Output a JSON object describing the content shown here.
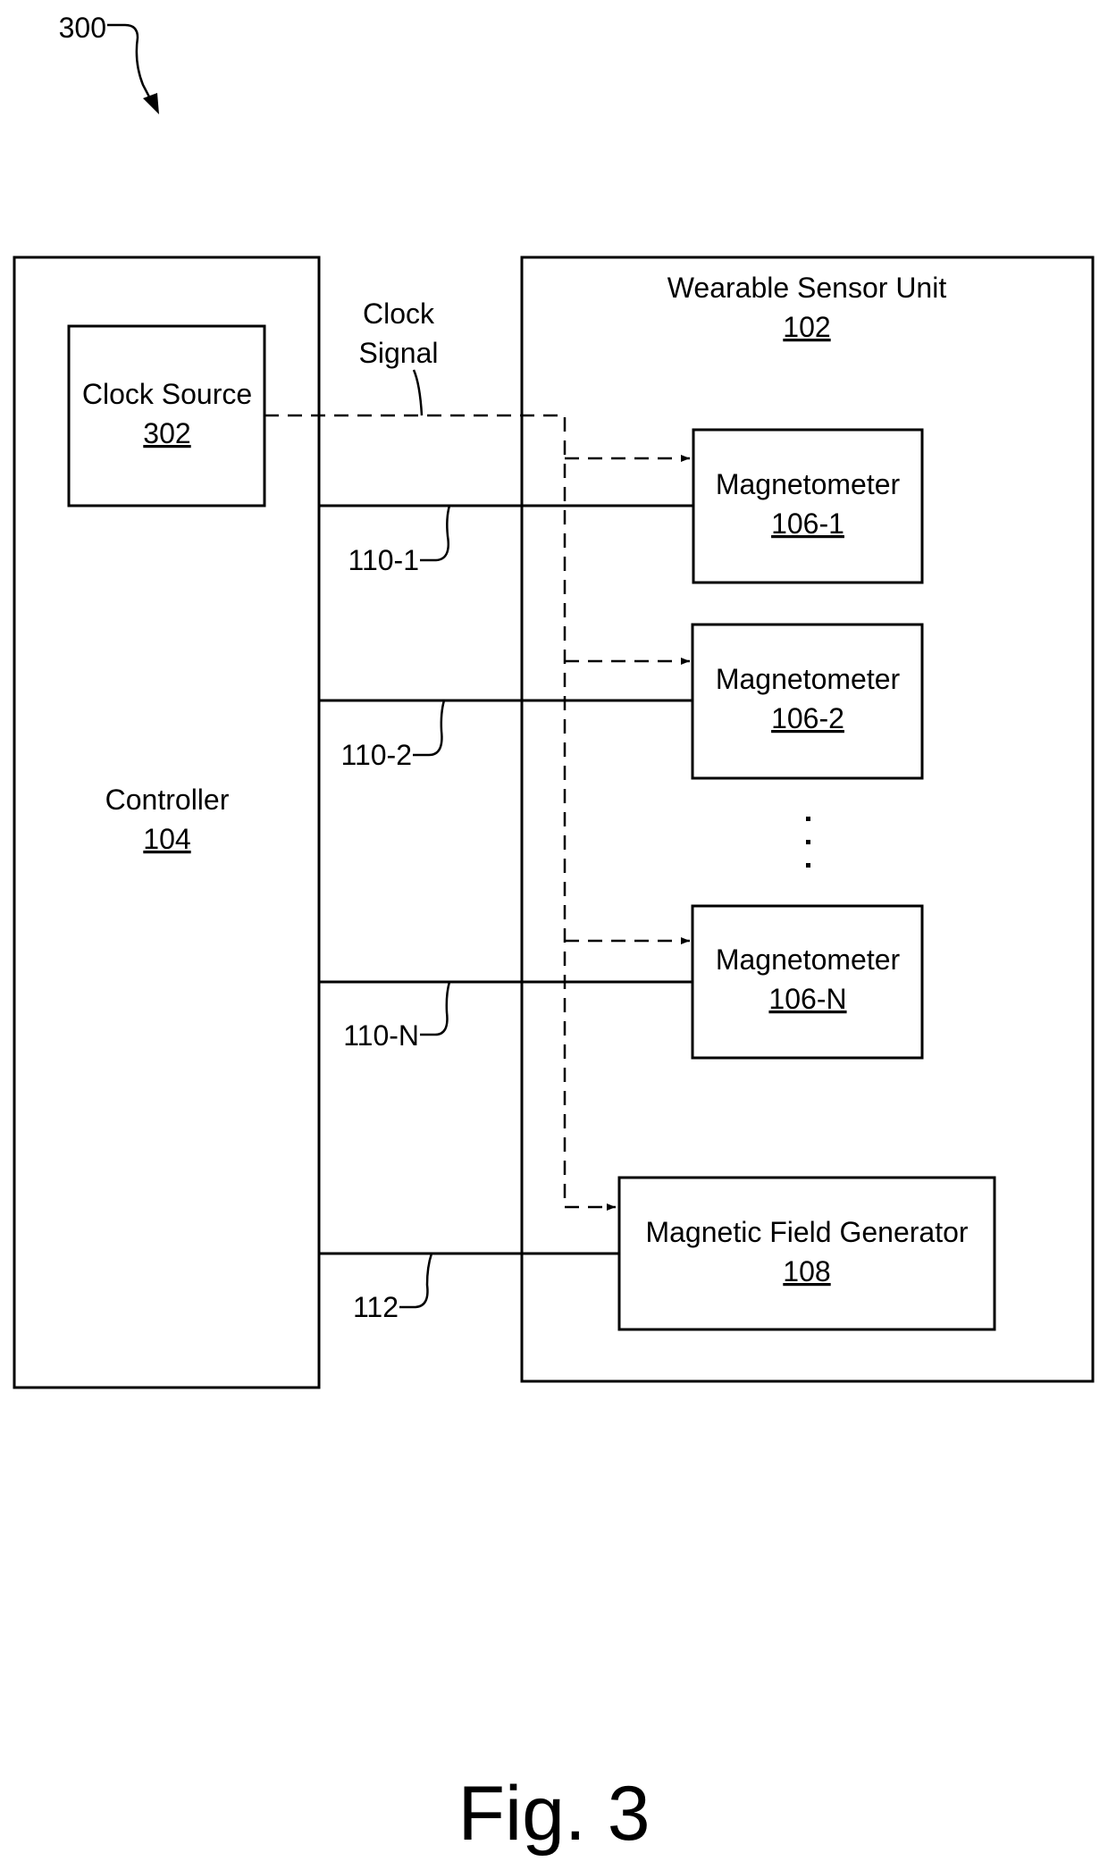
{
  "figure": {
    "reference_number": "300",
    "caption": "Fig. 3"
  },
  "controller": {
    "title": "Controller",
    "ref": "104"
  },
  "clock_source": {
    "title": "Clock Source",
    "ref": "302"
  },
  "clock_signal": {
    "line1": "Clock",
    "line2": "Signal"
  },
  "wearable_sensor_unit": {
    "title": "Wearable Sensor Unit",
    "ref": "102"
  },
  "magnetometers": [
    {
      "title": "Magnetometer",
      "ref": "106-1",
      "link": "110-1"
    },
    {
      "title": "Magnetometer",
      "ref": "106-2",
      "link": "110-2"
    },
    {
      "title": "Magnetometer",
      "ref": "106-N",
      "link": "110-N"
    }
  ],
  "ellipsis": "⋮",
  "magnetic_field_generator": {
    "title": "Magnetic Field Generator",
    "ref": "108",
    "link": "112"
  }
}
